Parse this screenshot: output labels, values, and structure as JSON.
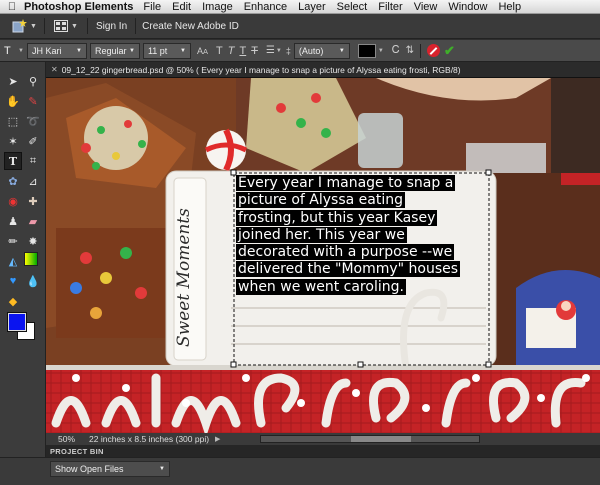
{
  "menubar": {
    "app_name": "Photoshop Elements",
    "items": [
      "File",
      "Edit",
      "Image",
      "Enhance",
      "Layer",
      "Select",
      "Filter",
      "View",
      "Window",
      "Help"
    ]
  },
  "topbar": {
    "sign_in": "Sign In",
    "create_id": "Create New Adobe ID"
  },
  "options_bar": {
    "font_family": "JH Kari",
    "font_style": "Regular",
    "font_size": "11 pt",
    "leading": "(Auto)",
    "text_color": "#000000",
    "cancel_color": "#d9232d",
    "commit_color": "#3fae2a"
  },
  "document": {
    "tab_title": "09_12_22 gingerbread.psd @ 50% ( Every year I manage to snap a picture of Alyssa eating frosti, RGB/8)"
  },
  "canvas": {
    "journal_title": "Sweet Moments",
    "journal_lines": [
      "Every year I manage to snap a",
      "picture of Alyssa eating",
      "frosting, but this year Kasey",
      "joined her. This year we",
      "decorated with a purpose --we",
      "delivered the \"Mommy\" houses",
      "when we went caroling."
    ]
  },
  "status_bar": {
    "zoom": "50%",
    "doc_size": "22 inches x 8.5 inches (300 ppi)"
  },
  "project_bin": {
    "header": "PROJECT BIN",
    "dropdown": "Show Open Files"
  },
  "colors": {
    "foreground": "#0a14f0",
    "background": "#ffffff"
  }
}
